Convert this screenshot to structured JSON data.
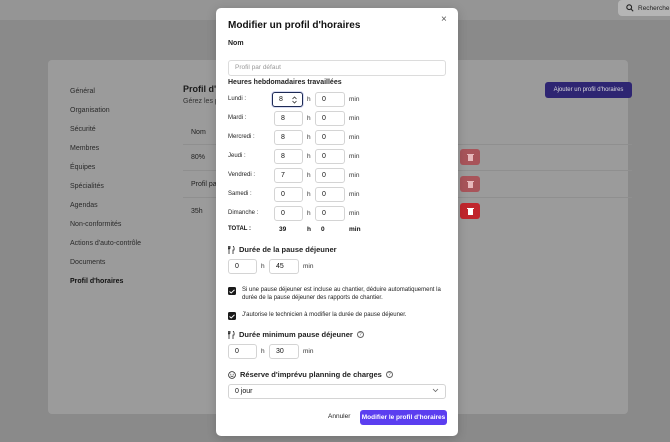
{
  "background": {
    "search_label": "Recherche",
    "nav": [
      "Général",
      "Organisation",
      "Sécurité",
      "Membres",
      "Équipes",
      "Spécialités",
      "Agendas",
      "Non-conformités",
      "Actions d'auto-contrôle",
      "Documents",
      "Profil d'horaires"
    ],
    "title": "Profil d'h",
    "subtitle": "Gérez les p",
    "add_button": "Ajouter un profil d'horaires",
    "column_name": "Nom",
    "rows": [
      "80%",
      "Profil pa",
      "35h"
    ]
  },
  "modal": {
    "title": "Modifier un profil d'horaires",
    "close": "×",
    "name_label": "Nom",
    "name_placeholder": "Profil par défaut",
    "hours_label": "Heures hebdomadaires travaillées",
    "h_unit": "h",
    "min_unit": "min",
    "days": [
      {
        "label": "Lundi :",
        "h": "8",
        "min": "0"
      },
      {
        "label": "Mardi :",
        "h": "8",
        "min": "0"
      },
      {
        "label": "Mercredi :",
        "h": "8",
        "min": "0"
      },
      {
        "label": "Jeudi :",
        "h": "8",
        "min": "0"
      },
      {
        "label": "Vendredi :",
        "h": "7",
        "min": "0"
      },
      {
        "label": "Samedi :",
        "h": "0",
        "min": "0"
      },
      {
        "label": "Dimanche :",
        "h": "0",
        "min": "0"
      }
    ],
    "total": {
      "label": "TOTAL :",
      "h": "39",
      "min": "0"
    },
    "lunch_label": "Durée de la pause déjeuner",
    "lunch": {
      "h": "0",
      "min": "45"
    },
    "check1": "Si une pause déjeuner est incluse au chantier, déduire automatiquement la durée de la pause déjeuner des rapports de chantier.",
    "check2": "J'autorise le technicien à modifier la durée de pause déjeuner.",
    "min_lunch_label": "Durée minimum pause déjeuner",
    "min_lunch": {
      "h": "0",
      "min": "30"
    },
    "reserve_label": "Réserve d'imprévu planning de charges",
    "reserve_value": "0 jour",
    "cancel": "Annuler",
    "submit": "Modifier le profil d'horaires"
  },
  "colors": {
    "accent": "#5b3ef0",
    "danger": "#c0262d"
  }
}
